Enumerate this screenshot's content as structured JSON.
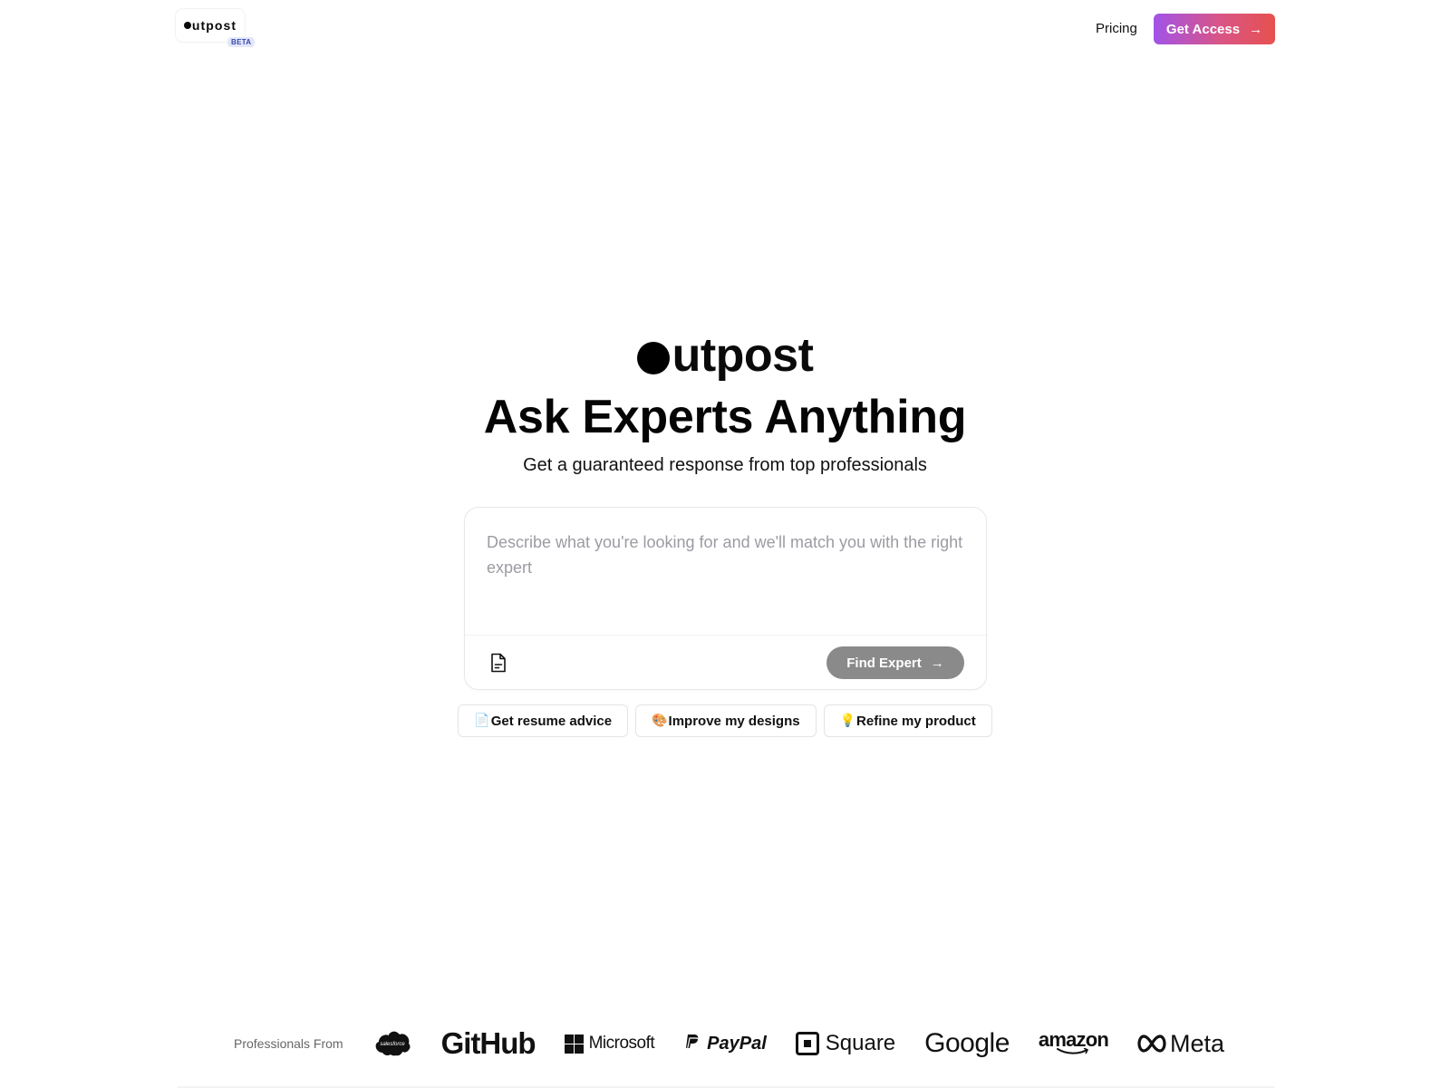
{
  "header": {
    "logo_text": "utpost",
    "beta_badge": "BETA",
    "nav_pricing": "Pricing",
    "cta_label": "Get Access",
    "cta_arrow": "→",
    "cta_gradient": [
      "#a153e8",
      "#d95585",
      "#e6514f"
    ]
  },
  "hero": {
    "logo_text": "utpost",
    "title": "Ask Experts Anything",
    "subtitle": "Get a guaranteed response from top professionals"
  },
  "composer": {
    "value": "",
    "placeholder": "Describe what you're looking for and we'll match you with the right expert",
    "attach_icon": "document-icon",
    "submit_label": "Find Expert",
    "submit_arrow": "→",
    "submit_color": "#8a8a8a"
  },
  "suggestions": [
    {
      "emoji": "📄",
      "icon": "page-icon",
      "label": "Get resume advice"
    },
    {
      "emoji": "🎨",
      "icon": "palette-icon",
      "label": "Improve my designs"
    },
    {
      "emoji": "💡",
      "icon": "lightbulb-icon",
      "label": "Refine my product"
    }
  ],
  "logos": {
    "label": "Professionals From",
    "brands": [
      {
        "name": "salesforce",
        "text": "salesforce"
      },
      {
        "name": "github",
        "text": "GitHub"
      },
      {
        "name": "microsoft",
        "text": "Microsoft"
      },
      {
        "name": "paypal",
        "text": "PayPal"
      },
      {
        "name": "square",
        "text": "Square"
      },
      {
        "name": "google",
        "text": "Google"
      },
      {
        "name": "amazon",
        "text": "amazon"
      },
      {
        "name": "meta",
        "text": "Meta"
      }
    ]
  }
}
